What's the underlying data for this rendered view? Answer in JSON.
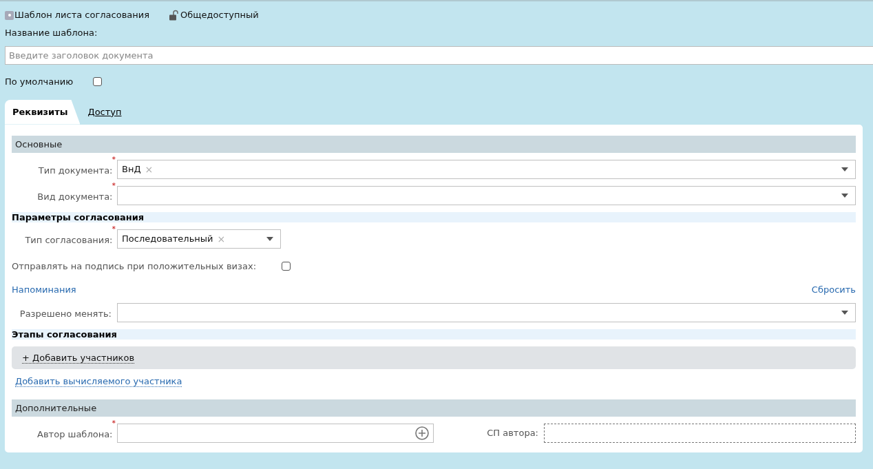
{
  "header": {
    "title": "Шаблон листа согласования",
    "access": "Общедоступный"
  },
  "name_field": {
    "label": "Название шаблона:",
    "placeholder": "Введите заголовок документа"
  },
  "default_checkbox": {
    "label": "По умолчанию",
    "checked": false
  },
  "tabs": [
    {
      "label": "Реквизиты",
      "selected": true
    },
    {
      "label": "Доступ",
      "selected": false
    }
  ],
  "sections": [
    {
      "kind": "header",
      "title": "Основные"
    },
    {
      "kind": "select",
      "label": "Тип документа:",
      "required_mark": "*",
      "value": "ВнД",
      "clear": "×"
    },
    {
      "kind": "select",
      "label": "Вид документа:",
      "required_mark": "*"
    },
    {
      "kind": "subheader",
      "title": "Параметры согласования"
    },
    {
      "kind": "short_select",
      "label": "Тип согласования:",
      "required_mark": "*",
      "value": "Последовательный",
      "clear": "×"
    },
    {
      "kind": "checkbox",
      "label": "Отправлять на подпись при положительных визах:",
      "checked": false
    },
    {
      "kind": "links",
      "left": "Напоминания",
      "right": "Сбросить"
    },
    {
      "kind": "select",
      "label": "Разрешено менять:"
    },
    {
      "kind": "subheader",
      "title": "Этапы согласования"
    },
    {
      "kind": "addbar",
      "label": "+ Добавить участников"
    },
    {
      "kind": "link",
      "label": "Добавить вычисляемого участника"
    },
    {
      "kind": "header",
      "title": "Дополнительные"
    },
    {
      "kind": "author",
      "label": "Автор шаблона:",
      "required_mark": "*",
      "label2": "СП автора:"
    }
  ]
}
